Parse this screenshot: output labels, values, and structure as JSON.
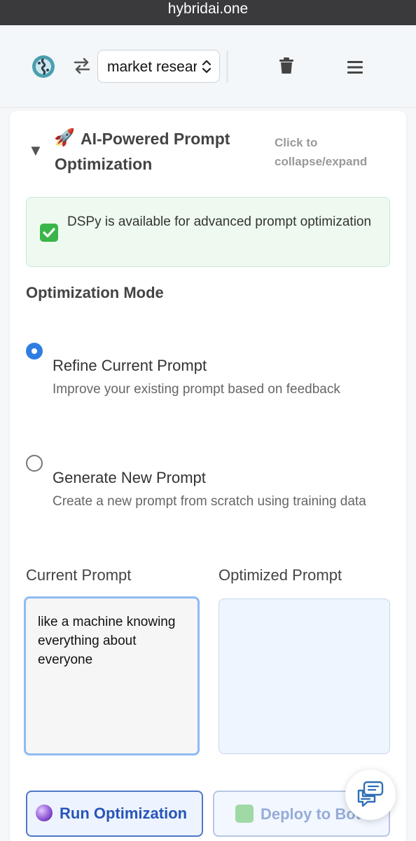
{
  "browser": {
    "url": "hybridai.one"
  },
  "header": {
    "agent_select": {
      "value": "market research"
    }
  },
  "section": {
    "title": "AI-Powered Prompt Optimization",
    "collapse_hint": "Click to collapse/expand",
    "status": {
      "message": "DSPy is available for advanced prompt optimization"
    },
    "mode_label": "Optimization Mode",
    "modes": [
      {
        "title": "Refine Current Prompt",
        "description": "Improve your existing prompt based on feedback",
        "selected": true
      },
      {
        "title": "Generate New Prompt",
        "description": "Create a new prompt from scratch using training data",
        "selected": false
      }
    ],
    "current_prompt": {
      "label": "Current Prompt",
      "value": "like a machine knowing everything about everyone"
    },
    "optimized_prompt": {
      "label": "Optimized Prompt",
      "value": ""
    },
    "buttons": {
      "run": "Run Optimization",
      "deploy": "Deploy to Bot"
    }
  },
  "colors": {
    "accent": "#2f7de1",
    "success": "#3bb54a",
    "primary_button_text": "#2755b8"
  }
}
